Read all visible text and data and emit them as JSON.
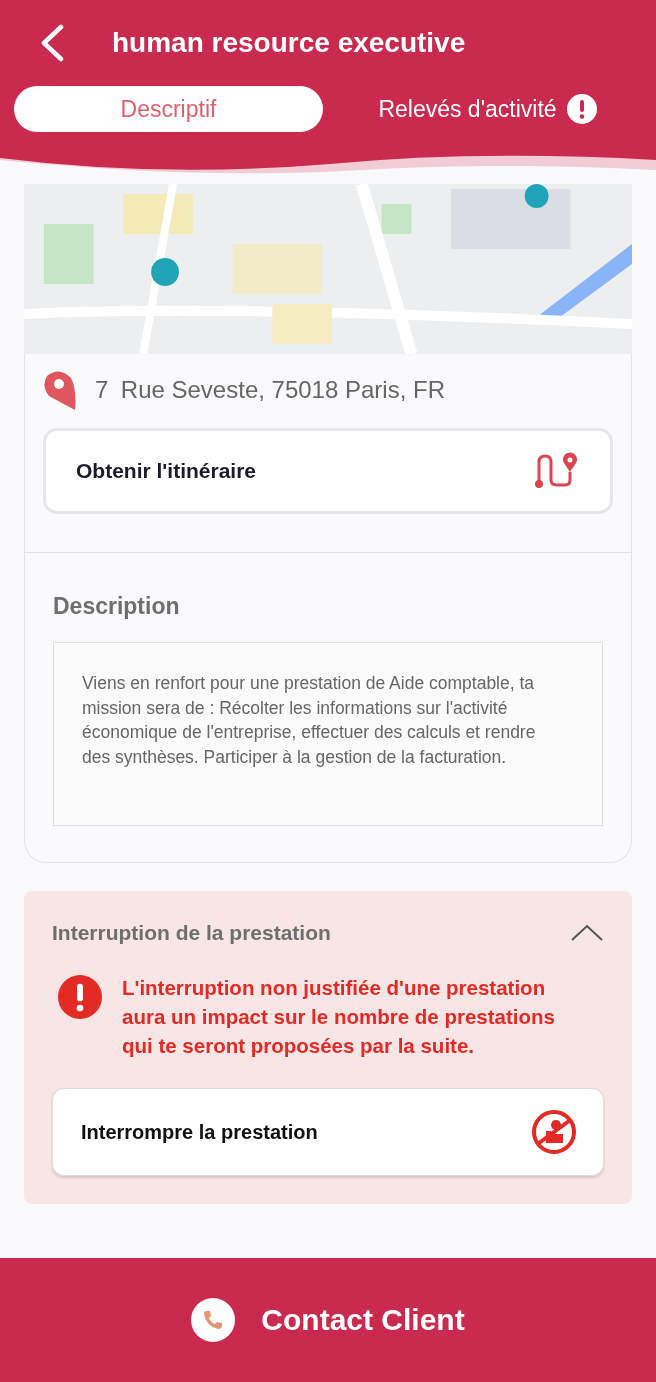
{
  "header": {
    "title": "human resource executive"
  },
  "tabs": [
    {
      "label": "Descriptif",
      "selected": true,
      "alert": false
    },
    {
      "label": "Relevés d'activité",
      "selected": false,
      "alert": true
    }
  ],
  "address": {
    "number": "7",
    "street": "Rue Seveste, 75018 Paris, FR"
  },
  "route_button": {
    "label": "Obtenir l'itinéraire"
  },
  "description": {
    "title": "Description",
    "text": "Viens en renfort pour une prestation de Aide comptable, ta mission sera de : Récolter les informations sur l'activité économique de l'entreprise, effectuer des calculs et rendre des synthèses. Participer à la gestion de la facturation."
  },
  "interruption": {
    "title": "Interruption de la prestation",
    "expanded": true,
    "warning": "L'interruption non justifiée d'une prestation aura un impact sur le nombre de prestations qui te seront proposées par la suite.",
    "button": "Interrompre la prestation"
  },
  "footer": {
    "label": "Contact Client"
  }
}
